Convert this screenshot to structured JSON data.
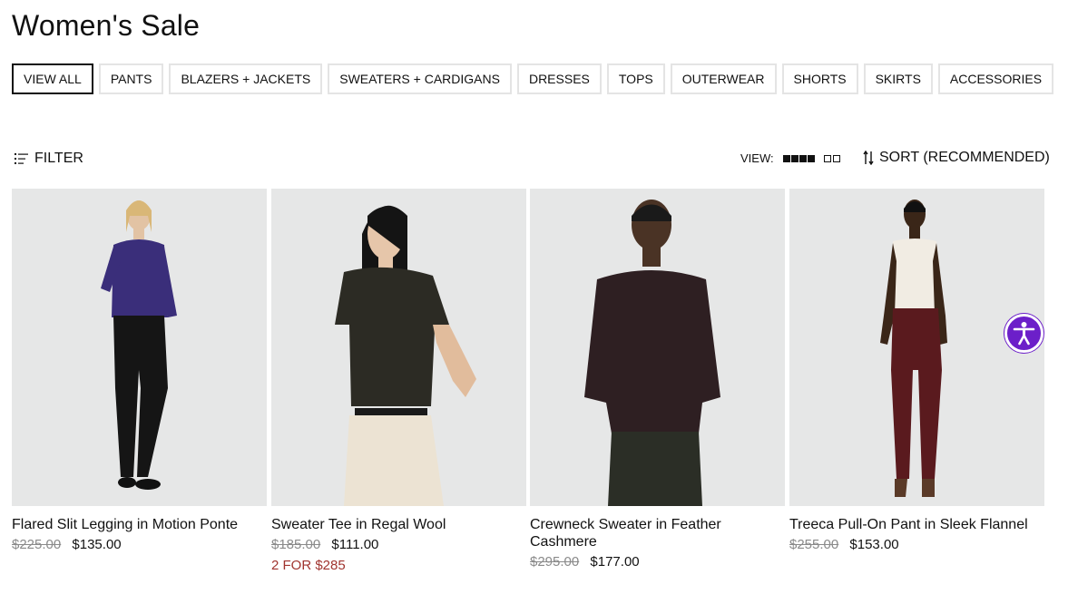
{
  "page": {
    "title": "Women's Sale"
  },
  "categories": [
    {
      "label": "VIEW ALL",
      "active": true
    },
    {
      "label": "PANTS"
    },
    {
      "label": "BLAZERS + JACKETS"
    },
    {
      "label": "SWEATERS + CARDIGANS"
    },
    {
      "label": "DRESSES"
    },
    {
      "label": "TOPS"
    },
    {
      "label": "OUTERWEAR"
    },
    {
      "label": "SHORTS"
    },
    {
      "label": "SKIRTS"
    },
    {
      "label": "ACCESSORIES"
    }
  ],
  "toolbar": {
    "filter_label": "FILTER",
    "view_label": "VIEW:",
    "sort_label": "SORT (RECOMMENDED)"
  },
  "products": [
    {
      "name": "Flared Slit Legging in Motion Ponte",
      "old_price": "$225.00",
      "price": "$135.00",
      "promo": ""
    },
    {
      "name": "Sweater Tee in Regal Wool",
      "old_price": "$185.00",
      "price": "$111.00",
      "promo": "2 FOR $285"
    },
    {
      "name": "Crewneck Sweater in Feather Cashmere",
      "old_price": "$295.00",
      "price": "$177.00",
      "promo": ""
    },
    {
      "name": "Treeca Pull-On Pant in Sleek Flannel",
      "old_price": "$255.00",
      "price": "$153.00",
      "promo": ""
    }
  ],
  "colors": {
    "promo": "#a0342f",
    "accessibility": "#6c1fc9",
    "photo_bg": "#e6e7e7"
  },
  "icons": {
    "filter": "filter-icon",
    "sort": "sort-icon",
    "accessibility": "accessibility-icon"
  }
}
